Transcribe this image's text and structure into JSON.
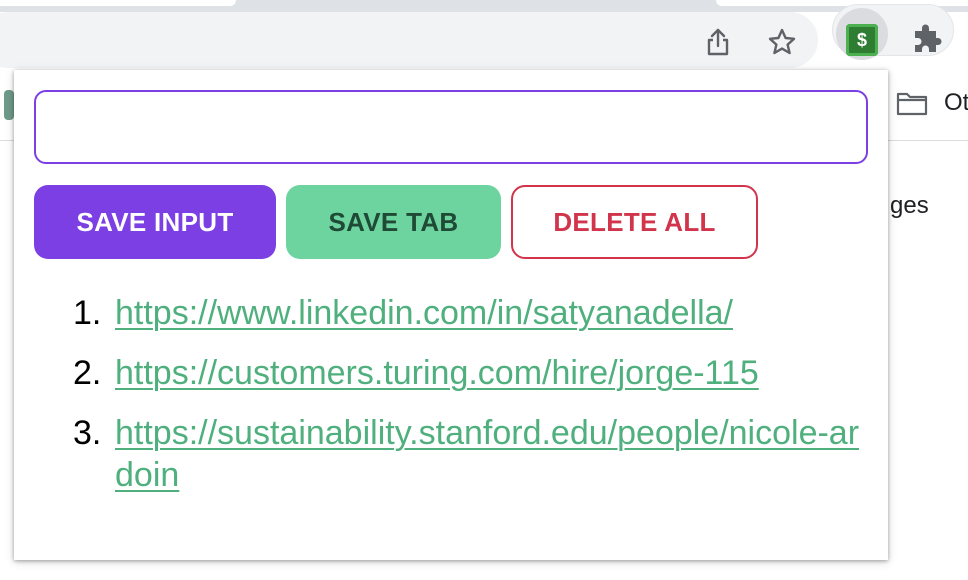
{
  "browser": {
    "bookmarks": {
      "other_label": "Ot"
    },
    "page_partial_text": "ges",
    "extension_icon_symbol": "$",
    "icons": [
      "share-icon",
      "star-icon",
      "dollar-extension-icon",
      "puzzle-extensions-icon",
      "folder-icon"
    ]
  },
  "popup": {
    "input": {
      "value": "",
      "placeholder": ""
    },
    "buttons": {
      "save_input": "SAVE INPUT",
      "save_tab": "SAVE TAB",
      "delete_all": "DELETE ALL"
    },
    "leads": [
      {
        "num": "1.",
        "url": "https://www.linkedin.com/in/satyanadella/"
      },
      {
        "num": "2.",
        "url": "https://customers.turing.com/hire/jorge-115"
      },
      {
        "num": "3.",
        "url": "https://sustainability.stanford.edu/people/nicole-ardoin"
      }
    ]
  },
  "colors": {
    "primary_purple": "#7b3fe4",
    "save_tab_green": "#6dd39f",
    "delete_red": "#d1344b",
    "link_green": "#4fb07e"
  }
}
